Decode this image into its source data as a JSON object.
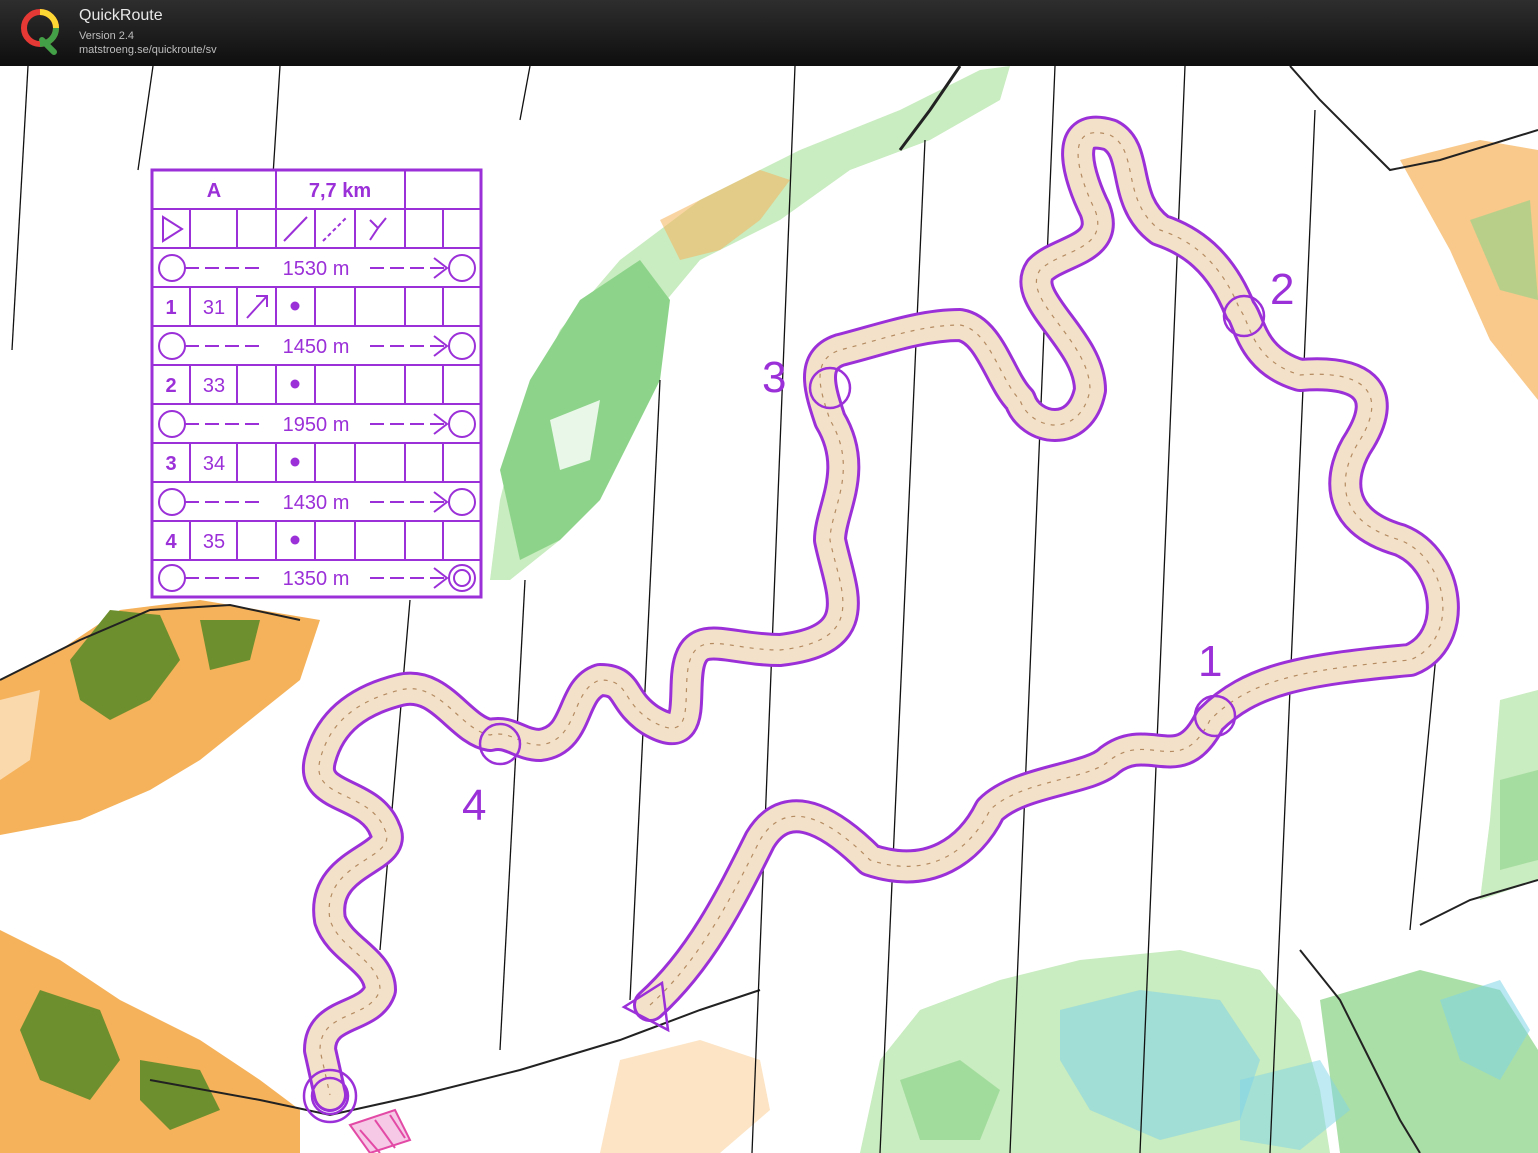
{
  "app": {
    "name": "QuickRoute",
    "version": "Version 2.4",
    "url": "matstroeng.se/quickroute/sv"
  },
  "course_description": {
    "class": "A",
    "length": "7,7 km",
    "legs": [
      {
        "distance": "1530 m"
      },
      {
        "number": "1",
        "code": "31",
        "distance": "1450 m"
      },
      {
        "number": "2",
        "code": "33",
        "distance": "1950 m"
      },
      {
        "number": "3",
        "code": "34",
        "distance": "1430 m"
      },
      {
        "number": "4",
        "code": "35",
        "distance": "1350 m"
      }
    ]
  },
  "controls": [
    {
      "label": "1"
    },
    {
      "label": "2"
    },
    {
      "label": "3"
    },
    {
      "label": "4"
    }
  ],
  "colors": {
    "course": "#9b30d8",
    "open_land": "#f5b25a",
    "forest_green": "#8dd48a",
    "light_green": "#c9ecc0",
    "marsh_blue": "#7fd3e8",
    "settlement": "#6e8f2e"
  }
}
